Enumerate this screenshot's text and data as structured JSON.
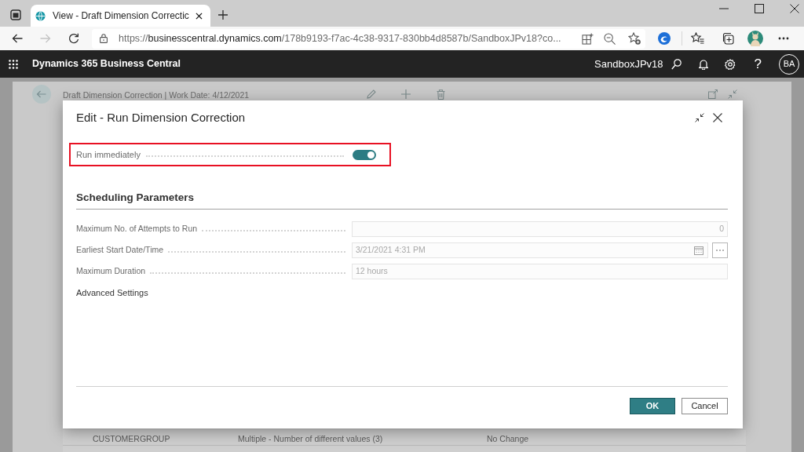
{
  "browser": {
    "tab": {
      "title": "View - Draft Dimension Correctic",
      "selected": true
    },
    "forward": {
      "disabled": true
    },
    "url": {
      "scheme": "https://",
      "host": "businesscentral.dynamics.com",
      "path": "/178b9193-f7ac-4c38-9317-830bb4d8587b/SandboxJPv18?co..."
    }
  },
  "app_bar": {
    "title": "Dynamics 365 Business Central",
    "environment": "SandboxJPv18",
    "help": "?",
    "user_initials": "BA"
  },
  "background_page": {
    "title": "Draft Dimension Correction | Work Date: 4/12/2021",
    "rows": [
      {
        "cells": [
          "CUSTOMERGROUP",
          "Multiple - Number of different values (3)",
          "No Change"
        ]
      }
    ]
  },
  "dialog": {
    "title": "Edit - Run Dimension Correction",
    "run_immediately": {
      "label": "Run immediately",
      "on": true,
      "highlighted": true
    },
    "section": {
      "title": "Scheduling Parameters",
      "fields": [
        {
          "kind": "number",
          "label": "Maximum No. of Attempts to Run",
          "value": "0",
          "disabled": true
        },
        {
          "kind": "datetime",
          "label": "Earliest Start Date/Time",
          "value": "3/21/2021 4:31 PM",
          "disabled": true
        },
        {
          "kind": "text",
          "label": "Maximum Duration",
          "value": "12 hours",
          "disabled": true
        }
      ]
    },
    "advanced_settings": {
      "label": "Advanced Settings"
    },
    "buttons": [
      {
        "label": "OK",
        "kind": "primary"
      },
      {
        "label": "Cancel",
        "kind": "secondary"
      }
    ]
  }
}
